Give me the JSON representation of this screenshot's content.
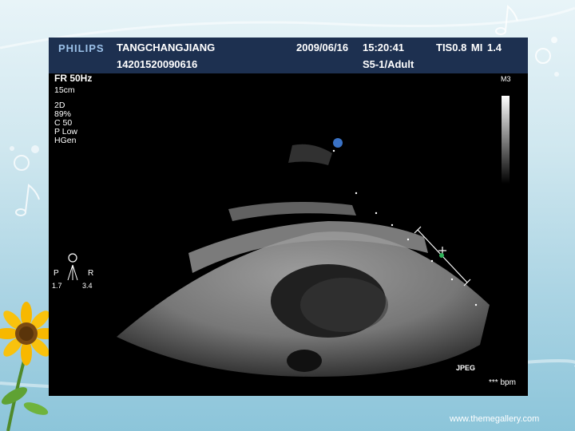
{
  "header": {
    "brand": "PHILIPS",
    "patient_name": "TANGCHANGJIANG",
    "patient_id": "14201520090616",
    "date": "2009/06/16",
    "time": "15:20:41",
    "probe": "S5-1/Adult",
    "indices": "TIS0.8   MI 1.4"
  },
  "imaging": {
    "frame_rate": "FR 50Hz",
    "depth": "15cm",
    "params": [
      "2D",
      "89%",
      "C 50",
      "P Low",
      "HGen"
    ],
    "map": "M3",
    "orientation": {
      "marker": "P",
      "left": "P",
      "right": "R",
      "left_value": "1.7",
      "right_value": "3.4"
    },
    "format": "JPEG",
    "heart_rate": "*** bpm"
  },
  "caption": "www.themegallery.com",
  "colors": {
    "header_bg": "#1d3050",
    "brand": "#9cc2ea",
    "background": "#a9d3e3"
  }
}
